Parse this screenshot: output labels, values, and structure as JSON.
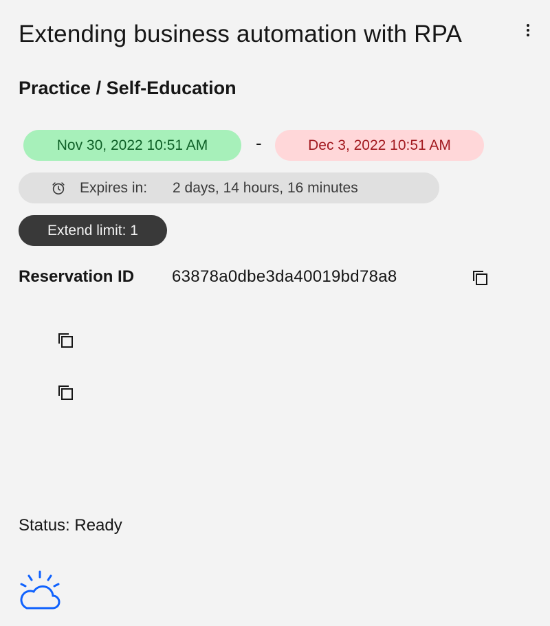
{
  "card": {
    "title": "Extending business automation with RPA",
    "subtitle": "Practice / Self-Education",
    "overflow_menu_icon": "overflow-menu-vertical-icon"
  },
  "schedule": {
    "start": "Nov 30, 2022 10:51 AM",
    "separator": "-",
    "end": "Dec 3, 2022 10:51 AM",
    "expires_label": "Expires in:",
    "expires_value": "2 days, 14 hours, 16 minutes",
    "extend_limit": "Extend limit: 1",
    "colors": {
      "start_bg": "#a7f0ba",
      "start_text": "#0e6027",
      "end_bg": "#ffd7d9",
      "end_text": "#a2191f",
      "expires_bg": "#e0e0e0",
      "extend_bg": "#393939"
    }
  },
  "reservation": {
    "label": "Reservation ID",
    "value": "63878a0dbe3da40019bd78a8",
    "copy_icon": "copy-icon"
  },
  "status": {
    "text": "Status: Ready"
  },
  "logo": {
    "icon": "ibm-cloud-icon",
    "color": "#0f62fe"
  }
}
